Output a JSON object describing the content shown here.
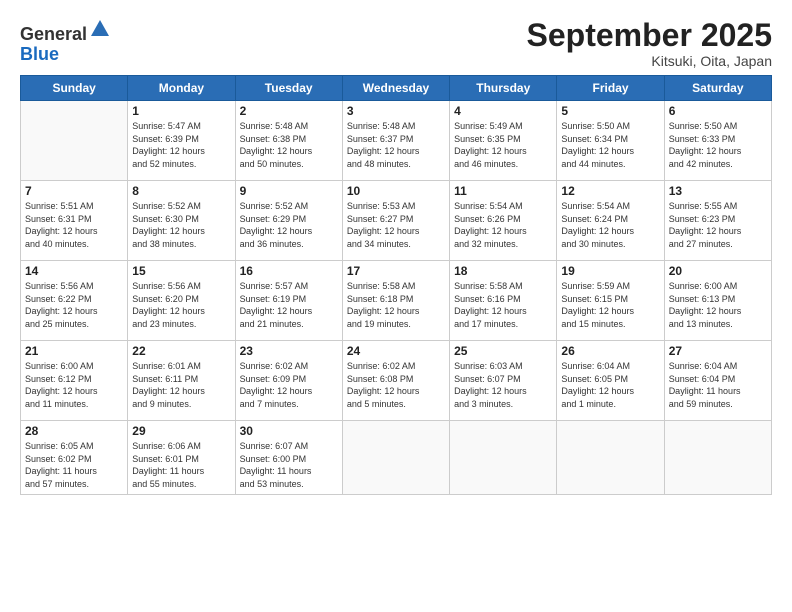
{
  "logo": {
    "general": "General",
    "blue": "Blue"
  },
  "header": {
    "month": "September 2025",
    "location": "Kitsuki, Oita, Japan"
  },
  "days": [
    "Sunday",
    "Monday",
    "Tuesday",
    "Wednesday",
    "Thursday",
    "Friday",
    "Saturday"
  ],
  "weeks": [
    [
      {
        "date": "",
        "info": ""
      },
      {
        "date": "1",
        "info": "Sunrise: 5:47 AM\nSunset: 6:39 PM\nDaylight: 12 hours\nand 52 minutes."
      },
      {
        "date": "2",
        "info": "Sunrise: 5:48 AM\nSunset: 6:38 PM\nDaylight: 12 hours\nand 50 minutes."
      },
      {
        "date": "3",
        "info": "Sunrise: 5:48 AM\nSunset: 6:37 PM\nDaylight: 12 hours\nand 48 minutes."
      },
      {
        "date": "4",
        "info": "Sunrise: 5:49 AM\nSunset: 6:35 PM\nDaylight: 12 hours\nand 46 minutes."
      },
      {
        "date": "5",
        "info": "Sunrise: 5:50 AM\nSunset: 6:34 PM\nDaylight: 12 hours\nand 44 minutes."
      },
      {
        "date": "6",
        "info": "Sunrise: 5:50 AM\nSunset: 6:33 PM\nDaylight: 12 hours\nand 42 minutes."
      }
    ],
    [
      {
        "date": "7",
        "info": "Sunrise: 5:51 AM\nSunset: 6:31 PM\nDaylight: 12 hours\nand 40 minutes."
      },
      {
        "date": "8",
        "info": "Sunrise: 5:52 AM\nSunset: 6:30 PM\nDaylight: 12 hours\nand 38 minutes."
      },
      {
        "date": "9",
        "info": "Sunrise: 5:52 AM\nSunset: 6:29 PM\nDaylight: 12 hours\nand 36 minutes."
      },
      {
        "date": "10",
        "info": "Sunrise: 5:53 AM\nSunset: 6:27 PM\nDaylight: 12 hours\nand 34 minutes."
      },
      {
        "date": "11",
        "info": "Sunrise: 5:54 AM\nSunset: 6:26 PM\nDaylight: 12 hours\nand 32 minutes."
      },
      {
        "date": "12",
        "info": "Sunrise: 5:54 AM\nSunset: 6:24 PM\nDaylight: 12 hours\nand 30 minutes."
      },
      {
        "date": "13",
        "info": "Sunrise: 5:55 AM\nSunset: 6:23 PM\nDaylight: 12 hours\nand 27 minutes."
      }
    ],
    [
      {
        "date": "14",
        "info": "Sunrise: 5:56 AM\nSunset: 6:22 PM\nDaylight: 12 hours\nand 25 minutes."
      },
      {
        "date": "15",
        "info": "Sunrise: 5:56 AM\nSunset: 6:20 PM\nDaylight: 12 hours\nand 23 minutes."
      },
      {
        "date": "16",
        "info": "Sunrise: 5:57 AM\nSunset: 6:19 PM\nDaylight: 12 hours\nand 21 minutes."
      },
      {
        "date": "17",
        "info": "Sunrise: 5:58 AM\nSunset: 6:18 PM\nDaylight: 12 hours\nand 19 minutes."
      },
      {
        "date": "18",
        "info": "Sunrise: 5:58 AM\nSunset: 6:16 PM\nDaylight: 12 hours\nand 17 minutes."
      },
      {
        "date": "19",
        "info": "Sunrise: 5:59 AM\nSunset: 6:15 PM\nDaylight: 12 hours\nand 15 minutes."
      },
      {
        "date": "20",
        "info": "Sunrise: 6:00 AM\nSunset: 6:13 PM\nDaylight: 12 hours\nand 13 minutes."
      }
    ],
    [
      {
        "date": "21",
        "info": "Sunrise: 6:00 AM\nSunset: 6:12 PM\nDaylight: 12 hours\nand 11 minutes."
      },
      {
        "date": "22",
        "info": "Sunrise: 6:01 AM\nSunset: 6:11 PM\nDaylight: 12 hours\nand 9 minutes."
      },
      {
        "date": "23",
        "info": "Sunrise: 6:02 AM\nSunset: 6:09 PM\nDaylight: 12 hours\nand 7 minutes."
      },
      {
        "date": "24",
        "info": "Sunrise: 6:02 AM\nSunset: 6:08 PM\nDaylight: 12 hours\nand 5 minutes."
      },
      {
        "date": "25",
        "info": "Sunrise: 6:03 AM\nSunset: 6:07 PM\nDaylight: 12 hours\nand 3 minutes."
      },
      {
        "date": "26",
        "info": "Sunrise: 6:04 AM\nSunset: 6:05 PM\nDaylight: 12 hours\nand 1 minute."
      },
      {
        "date": "27",
        "info": "Sunrise: 6:04 AM\nSunset: 6:04 PM\nDaylight: 11 hours\nand 59 minutes."
      }
    ],
    [
      {
        "date": "28",
        "info": "Sunrise: 6:05 AM\nSunset: 6:02 PM\nDaylight: 11 hours\nand 57 minutes."
      },
      {
        "date": "29",
        "info": "Sunrise: 6:06 AM\nSunset: 6:01 PM\nDaylight: 11 hours\nand 55 minutes."
      },
      {
        "date": "30",
        "info": "Sunrise: 6:07 AM\nSunset: 6:00 PM\nDaylight: 11 hours\nand 53 minutes."
      },
      {
        "date": "",
        "info": ""
      },
      {
        "date": "",
        "info": ""
      },
      {
        "date": "",
        "info": ""
      },
      {
        "date": "",
        "info": ""
      }
    ]
  ]
}
